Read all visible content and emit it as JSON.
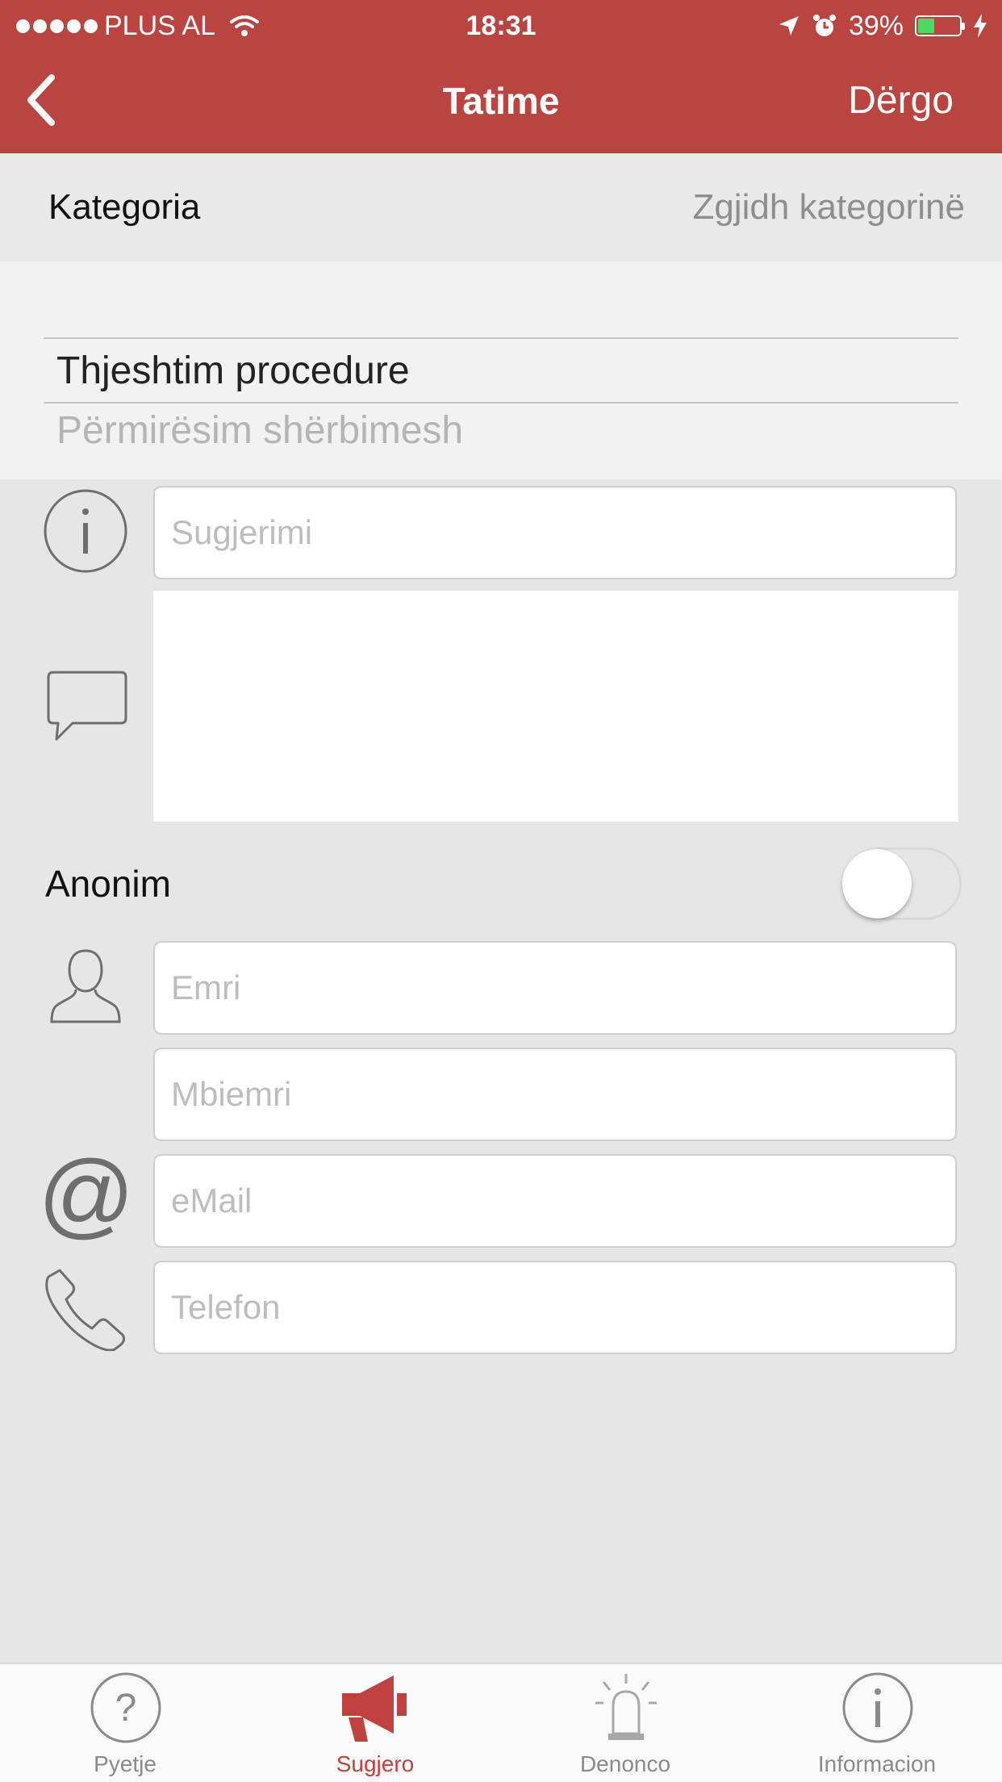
{
  "status_bar": {
    "carrier": "PLUS AL",
    "time": "18:31",
    "battery": "39%",
    "battery_level": 0.39
  },
  "nav": {
    "title": "Tatime",
    "send_label": "Dërgo"
  },
  "category": {
    "label": "Kategoria",
    "placeholder": "Zgjidh kategorinë"
  },
  "picker": {
    "selected": "Thjeshtim procedure",
    "next": "Përmirësim shërbimesh"
  },
  "form": {
    "suggestion_placeholder": "Sugjerimi",
    "anonymous_label": "Anonim",
    "anonymous_on": false,
    "first_name_placeholder": "Emri",
    "last_name_placeholder": "Mbiemri",
    "email_placeholder": "eMail",
    "phone_placeholder": "Telefon"
  },
  "tabs": [
    {
      "label": "Pyetje",
      "icon": "question-icon",
      "active": false
    },
    {
      "label": "Sugjero",
      "icon": "megaphone-icon",
      "active": true
    },
    {
      "label": "Denonco",
      "icon": "alarm-bell-icon",
      "active": false
    },
    {
      "label": "Informacion",
      "icon": "info-icon",
      "active": false
    }
  ],
  "colors": {
    "brand": "#b94440",
    "active_tab": "#c0413d",
    "inactive_tab": "#8a8a8a"
  }
}
